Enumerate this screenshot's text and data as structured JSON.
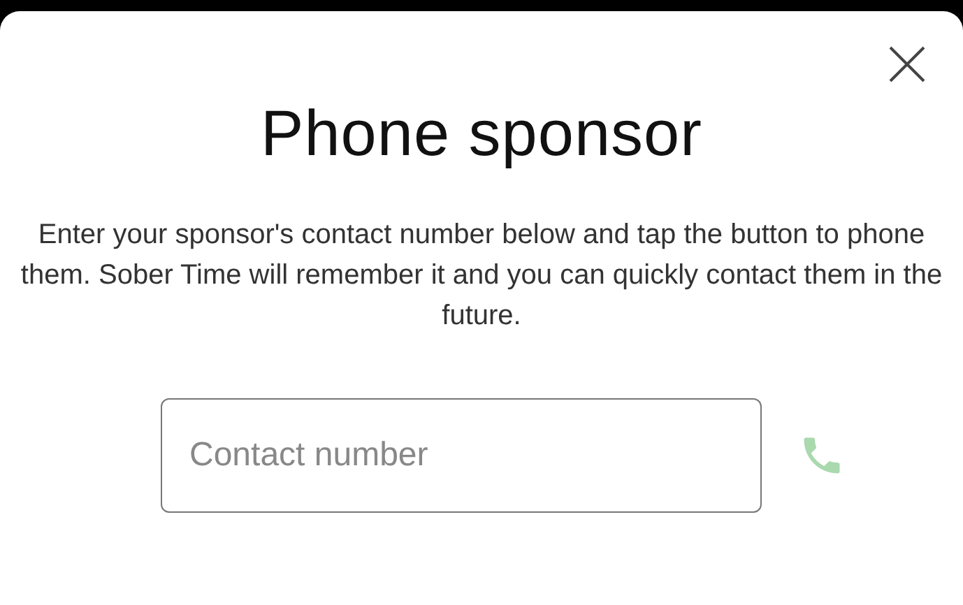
{
  "dialog": {
    "title": "Phone sponsor",
    "description": "Enter your sponsor's contact number below and tap the button to phone them. Sober Time will remember it and you can quickly contact them in the future.",
    "field": {
      "placeholder": "Contact number"
    },
    "call_button": {
      "disabled": true
    }
  }
}
